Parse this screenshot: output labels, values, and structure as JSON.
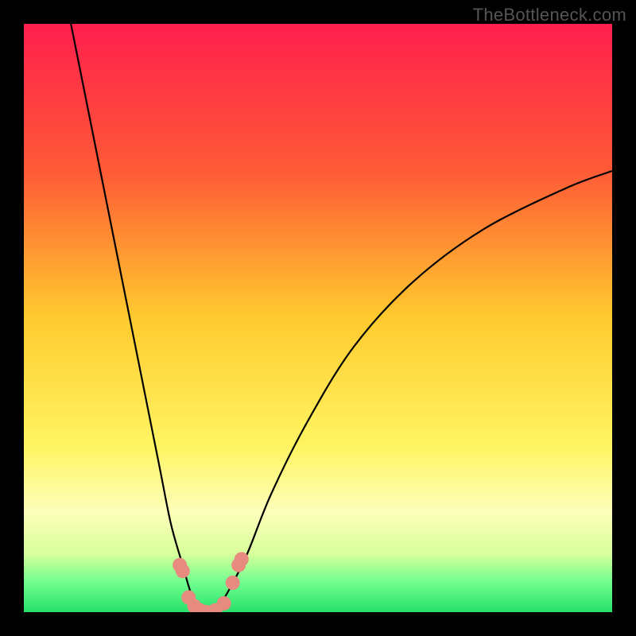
{
  "watermark": "TheBottleneck.com",
  "chart_data": {
    "type": "line",
    "title": "",
    "xlabel": "",
    "ylabel": "",
    "x_range": [
      0,
      100
    ],
    "y_range": [
      0,
      100
    ],
    "gradient_stops": [
      {
        "offset": 0,
        "color": "#ff1f4d"
      },
      {
        "offset": 25,
        "color": "#ff5a36"
      },
      {
        "offset": 50,
        "color": "#ffcb2f"
      },
      {
        "offset": 72,
        "color": "#fff563"
      },
      {
        "offset": 83,
        "color": "#fdffba"
      },
      {
        "offset": 90,
        "color": "#d8ff9b"
      },
      {
        "offset": 95,
        "color": "#6fff8f"
      },
      {
        "offset": 100,
        "color": "#27e06a"
      }
    ],
    "series": [
      {
        "name": "bottleneck-curve-left",
        "x": [
          8,
          12,
          16,
          20,
          23,
          25,
          27,
          28.5,
          30,
          31
        ],
        "y": [
          100,
          80,
          60,
          40,
          25,
          15,
          8,
          3,
          1,
          0
        ]
      },
      {
        "name": "bottleneck-curve-right",
        "x": [
          31,
          33,
          35,
          38,
          42,
          48,
          56,
          66,
          78,
          92,
          100
        ],
        "y": [
          0,
          1,
          4,
          10,
          20,
          32,
          45,
          56,
          65,
          72,
          75
        ]
      }
    ],
    "markers": [
      {
        "x": 26.5,
        "y": 8
      },
      {
        "x": 27.0,
        "y": 7
      },
      {
        "x": 28.0,
        "y": 2.5
      },
      {
        "x": 29.0,
        "y": 1.0
      },
      {
        "x": 30.0,
        "y": 0.3
      },
      {
        "x": 31.0,
        "y": 0.0
      },
      {
        "x": 32.5,
        "y": 0.3
      },
      {
        "x": 34.0,
        "y": 1.5
      },
      {
        "x": 35.5,
        "y": 5.0
      },
      {
        "x": 36.5,
        "y": 8.0
      },
      {
        "x": 37.0,
        "y": 9.0
      }
    ]
  }
}
